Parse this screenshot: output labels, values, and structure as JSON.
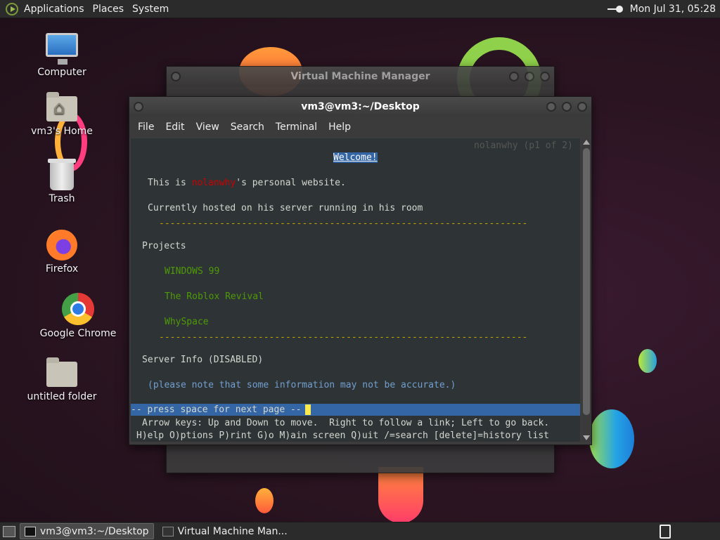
{
  "top_panel": {
    "menus": [
      "Applications",
      "Places",
      "System"
    ],
    "clock": "Mon Jul 31, 05:28"
  },
  "desktop_icons": {
    "computer": "Computer",
    "home": "vm3's Home",
    "trash": "Trash",
    "firefox": "Firefox",
    "chrome": "Google Chrome",
    "folder": "untitled folder"
  },
  "vmm_window": {
    "title": "Virtual Machine Manager"
  },
  "terminal": {
    "title": "vm3@vm3:~/Desktop",
    "menus": [
      "File",
      "Edit",
      "View",
      "Search",
      "Terminal",
      "Help"
    ],
    "page_indicator": "nolanwhy (p1 of 2)",
    "welcome": "Welcome!",
    "intro_pre": "This is ",
    "intro_name": "nolanwhy",
    "intro_post": "'s personal website.",
    "hosted": "Currently hosted on his server running in his room",
    "divider": "-------------------------------------------------------------------",
    "projects_heading": "Projects",
    "projects": [
      "WINDOWS 99",
      "The Roblox Revival",
      "WhySpace"
    ],
    "server_info": "Server Info (DISABLED)",
    "note": "(please note that some information may not be accurate.)",
    "status": "-- press space for next page --",
    "help1": "Arrow keys: Up and Down to move.  Right to follow a link; Left to go back.",
    "help2": "H)elp O)ptions P)rint G)o M)ain screen Q)uit /=search [delete]=history list"
  },
  "taskbar": {
    "tasks": [
      "vm3@vm3:~/Desktop",
      "Virtual Machine Man..."
    ]
  },
  "colors": {
    "accent_blue": "#3465a4",
    "link_green": "#4e9a06",
    "divider_yellow": "#c4a000",
    "name_red": "#cc0000"
  }
}
